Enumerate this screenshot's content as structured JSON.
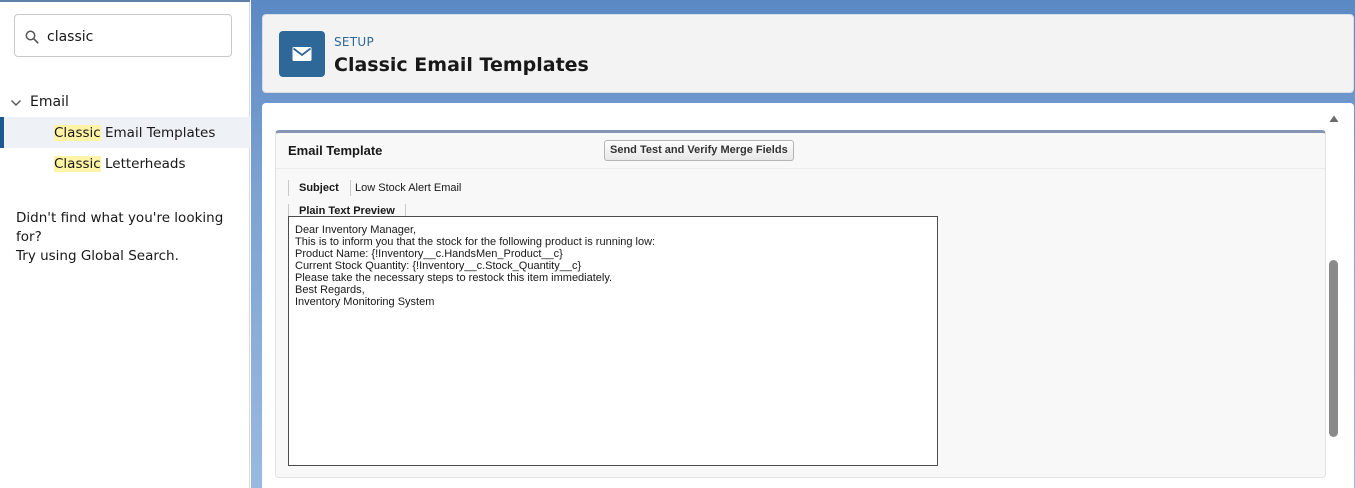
{
  "sidebar": {
    "search": {
      "value": "classic"
    },
    "tree": {
      "group_label": "Email",
      "items": [
        {
          "highlight": "Classic",
          "rest": " Email Templates",
          "selected": true
        },
        {
          "highlight": "Classic",
          "rest": " Letterheads",
          "selected": false
        }
      ]
    },
    "help": {
      "line1": "Didn't find what you're looking for?",
      "line2": "Try using Global Search."
    }
  },
  "header": {
    "icon": "envelope-icon",
    "setup_label": "SETUP",
    "title": "Classic Email Templates"
  },
  "panel": {
    "title": "Email Template",
    "send_test_label": "Send Test and Verify Merge Fields",
    "subject_label": "Subject",
    "subject_value": "Low Stock Alert Email",
    "preview_tab_label": "Plain Text Preview",
    "preview_lines": [
      "Dear Inventory Manager,",
      "This is to inform you that the stock for the following product is running low:",
      "Product Name: {!Inventory__c.HandsMen_Product__c}",
      "Current Stock Quantity: {!Inventory__c.Stock_Quantity__c}",
      "Please take the necessary steps to restock this item immediately.",
      "Best Regards,",
      "Inventory Monitoring System"
    ]
  },
  "colors": {
    "brand": "#2e6899",
    "highlight": "#fff3a5",
    "selected_bg": "#eef1f6"
  }
}
